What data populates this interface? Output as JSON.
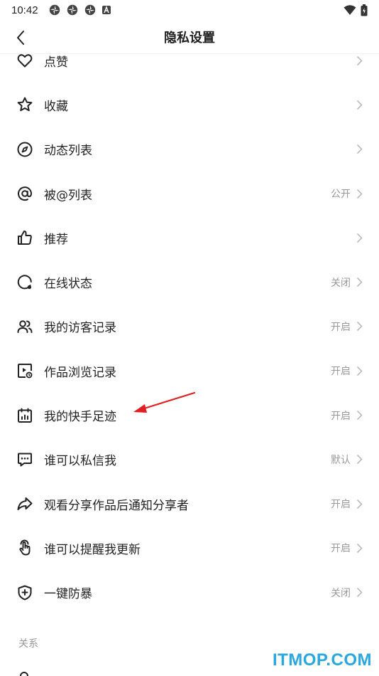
{
  "status_bar": {
    "time": "10:42"
  },
  "header": {
    "title": "隐私设置"
  },
  "rows": [
    {
      "label": "点赞",
      "value": ""
    },
    {
      "label": "收藏",
      "value": ""
    },
    {
      "label": "动态列表",
      "value": ""
    },
    {
      "label": "被@列表",
      "value": "公开"
    },
    {
      "label": "推荐",
      "value": ""
    },
    {
      "label": "在线状态",
      "value": "关闭"
    },
    {
      "label": "我的访客记录",
      "value": "开启"
    },
    {
      "label": "作品浏览记录",
      "value": "开启"
    },
    {
      "label": "我的快手足迹",
      "value": "开启"
    },
    {
      "label": "谁可以私信我",
      "value": "默认"
    },
    {
      "label": "观看分享作品后通知分享者",
      "value": "开启"
    },
    {
      "label": "谁可以提醒我更新",
      "value": "开启"
    },
    {
      "label": "一键防暴",
      "value": "关闭"
    }
  ],
  "section": {
    "relation": "关系"
  },
  "watermark": {
    "text": "ITMOP.COM"
  },
  "icons": [
    "heart-icon",
    "star-icon",
    "compass-icon",
    "at-icon",
    "thumbs-up-icon",
    "online-status-icon",
    "visitors-icon",
    "video-history-icon",
    "calendar-icon",
    "message-icon",
    "share-icon",
    "touch-icon",
    "shield-plus-icon"
  ],
  "colors": {
    "annotation_arrow": "#e02020",
    "watermark": "#2aa7de"
  }
}
